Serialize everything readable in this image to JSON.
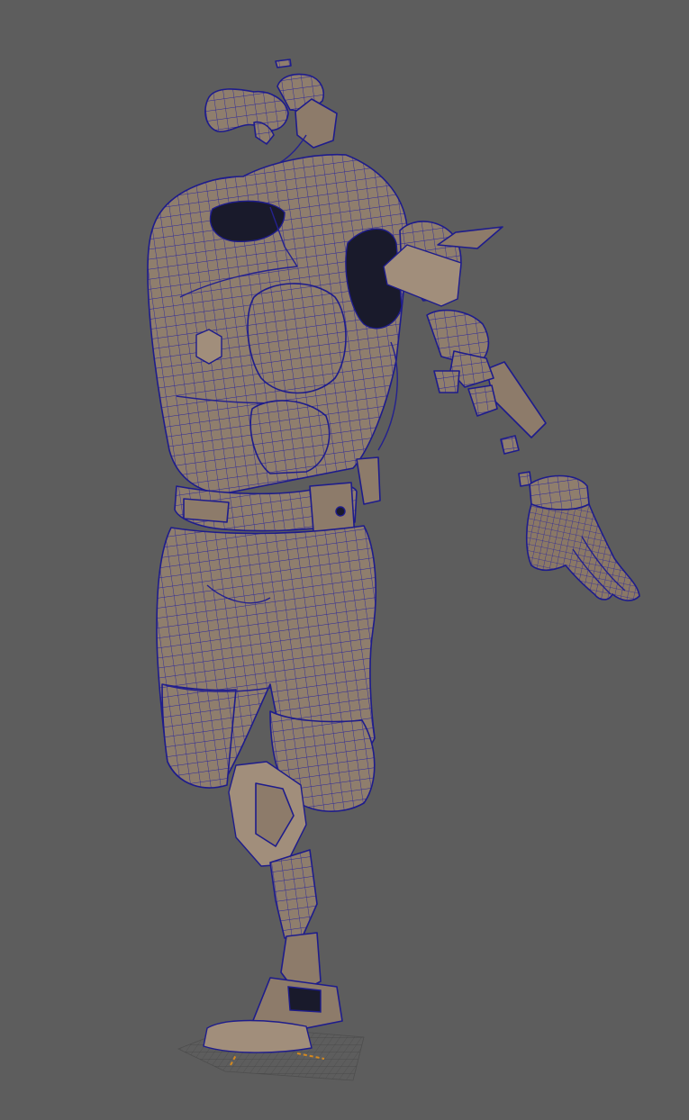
{
  "viewport": {
    "background": "#5d5d5d",
    "mesh_fill": "#8f7e6d",
    "wire_color": "#1e1c8c",
    "axis_color": "#d4891f",
    "display_mode": "wireframe-on-shaded",
    "scene_object": "character-model-exploded-parts"
  }
}
